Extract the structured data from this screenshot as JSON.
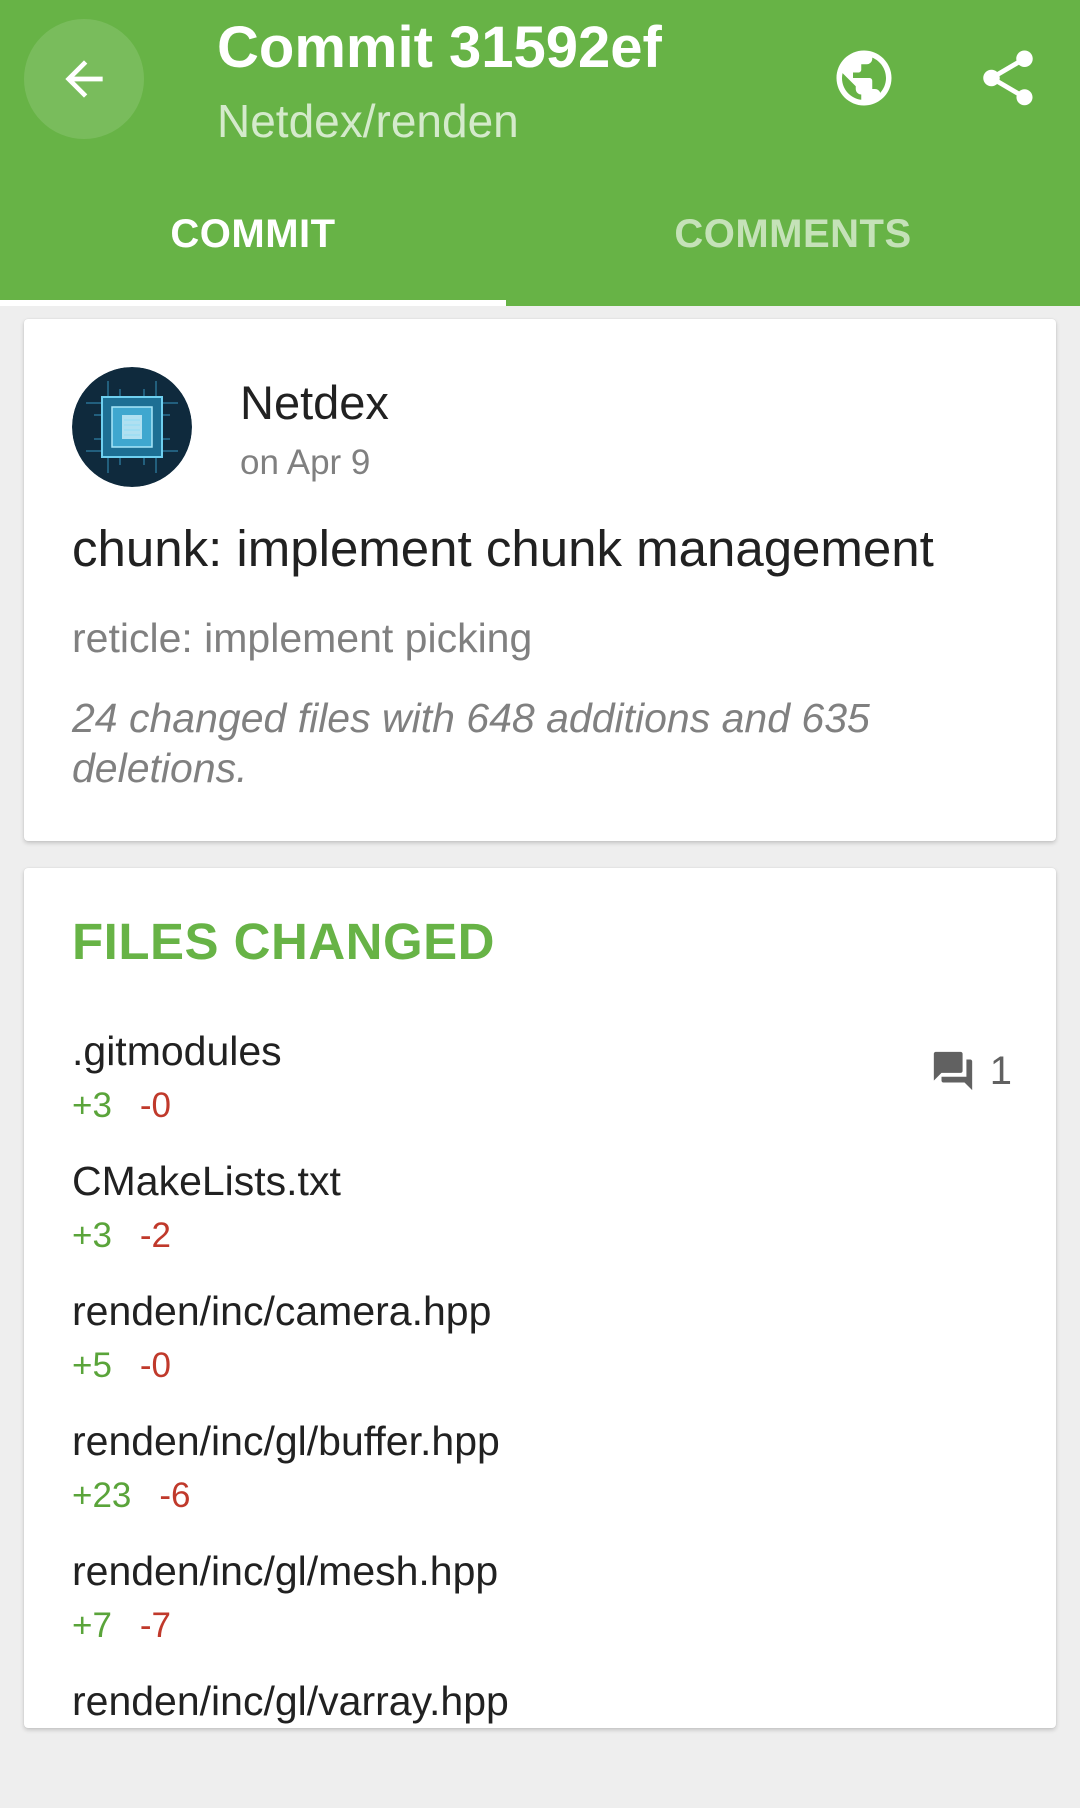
{
  "header": {
    "title": "Commit 31592ef",
    "subtitle": "Netdex/renden",
    "icons": {
      "back": "arrow-back-icon",
      "browser": "globe-icon",
      "share": "share-icon"
    }
  },
  "tabs": [
    {
      "label": "COMMIT",
      "active": true
    },
    {
      "label": "COMMENTS",
      "active": false
    }
  ],
  "commit": {
    "author": "Netdex",
    "date": "on Apr 9",
    "message": "chunk: implement chunk management",
    "description": "reticle: implement picking",
    "stats": "24 changed files with 648 additions and 635 deletions."
  },
  "files_changed": {
    "heading": "FILES CHANGED",
    "items": [
      {
        "name": ".gitmodules",
        "additions": "+3",
        "deletions": "-0",
        "comments": "1"
      },
      {
        "name": "CMakeLists.txt",
        "additions": "+3",
        "deletions": "-2"
      },
      {
        "name": "renden/inc/camera.hpp",
        "additions": "+5",
        "deletions": "-0"
      },
      {
        "name": "renden/inc/gl/buffer.hpp",
        "additions": "+23",
        "deletions": "-6"
      },
      {
        "name": "renden/inc/gl/mesh.hpp",
        "additions": "+7",
        "deletions": "-7"
      },
      {
        "name": "renden/inc/gl/varray.hpp",
        "additions": "",
        "deletions": ""
      }
    ]
  },
  "colors": {
    "primary": "#67b346",
    "addition": "#5aa43a",
    "deletion": "#c0392b"
  }
}
